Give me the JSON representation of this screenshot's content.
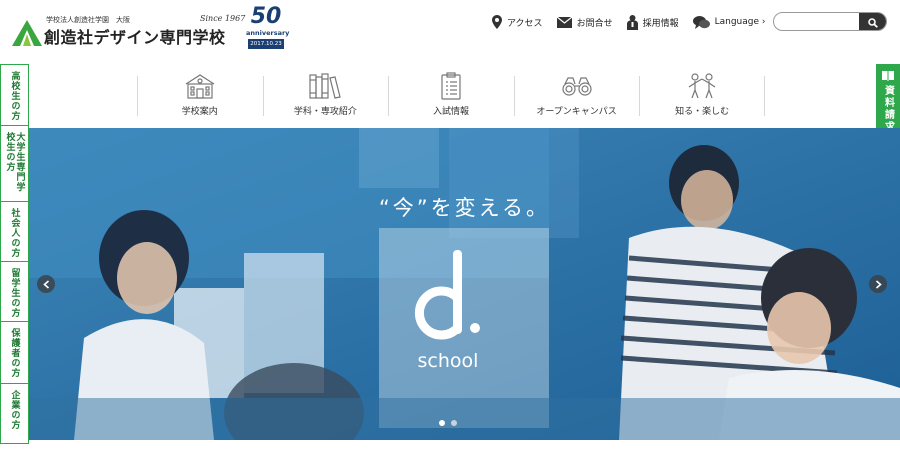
{
  "logo": {
    "small": "学校法人創造社学園　大阪",
    "main": "創造社デザイン専門学校",
    "since": "Since 1967",
    "anniversary_number": "50",
    "anniversary_word": "anniversary",
    "anniversary_date": "2017.10.23"
  },
  "topnav": {
    "access": "アクセス",
    "contact": "お問合せ",
    "recruit": "採用情報",
    "language": "Language ›"
  },
  "search": {
    "placeholder": "",
    "value": ""
  },
  "sidenav": [
    {
      "label": "高校生の方"
    },
    {
      "label": "大学生専門学校生の方"
    },
    {
      "label": "社会人の方"
    },
    {
      "label": "留学生の方"
    },
    {
      "label": "保護者の方"
    },
    {
      "label": "企業の方"
    }
  ],
  "request_tab": {
    "label": "資料請求"
  },
  "mainnav": [
    {
      "label": "学校案内",
      "icon": "school-building-icon"
    },
    {
      "label": "学科・専攻紹介",
      "icon": "books-icon"
    },
    {
      "label": "入試情報",
      "icon": "clipboard-icon"
    },
    {
      "label": "オープンキャンパス",
      "icon": "binoculars-icon"
    },
    {
      "label": "知る・楽しむ",
      "icon": "people-icon"
    }
  ],
  "hero": {
    "tagline": "“今”を変える。",
    "brand": "school",
    "slide_count": 2,
    "active_slide": 1
  },
  "colors": {
    "brand_green": "#2ea84a",
    "hero_blue": "#2a73a8",
    "anniversary_navy": "#1c3f73"
  }
}
